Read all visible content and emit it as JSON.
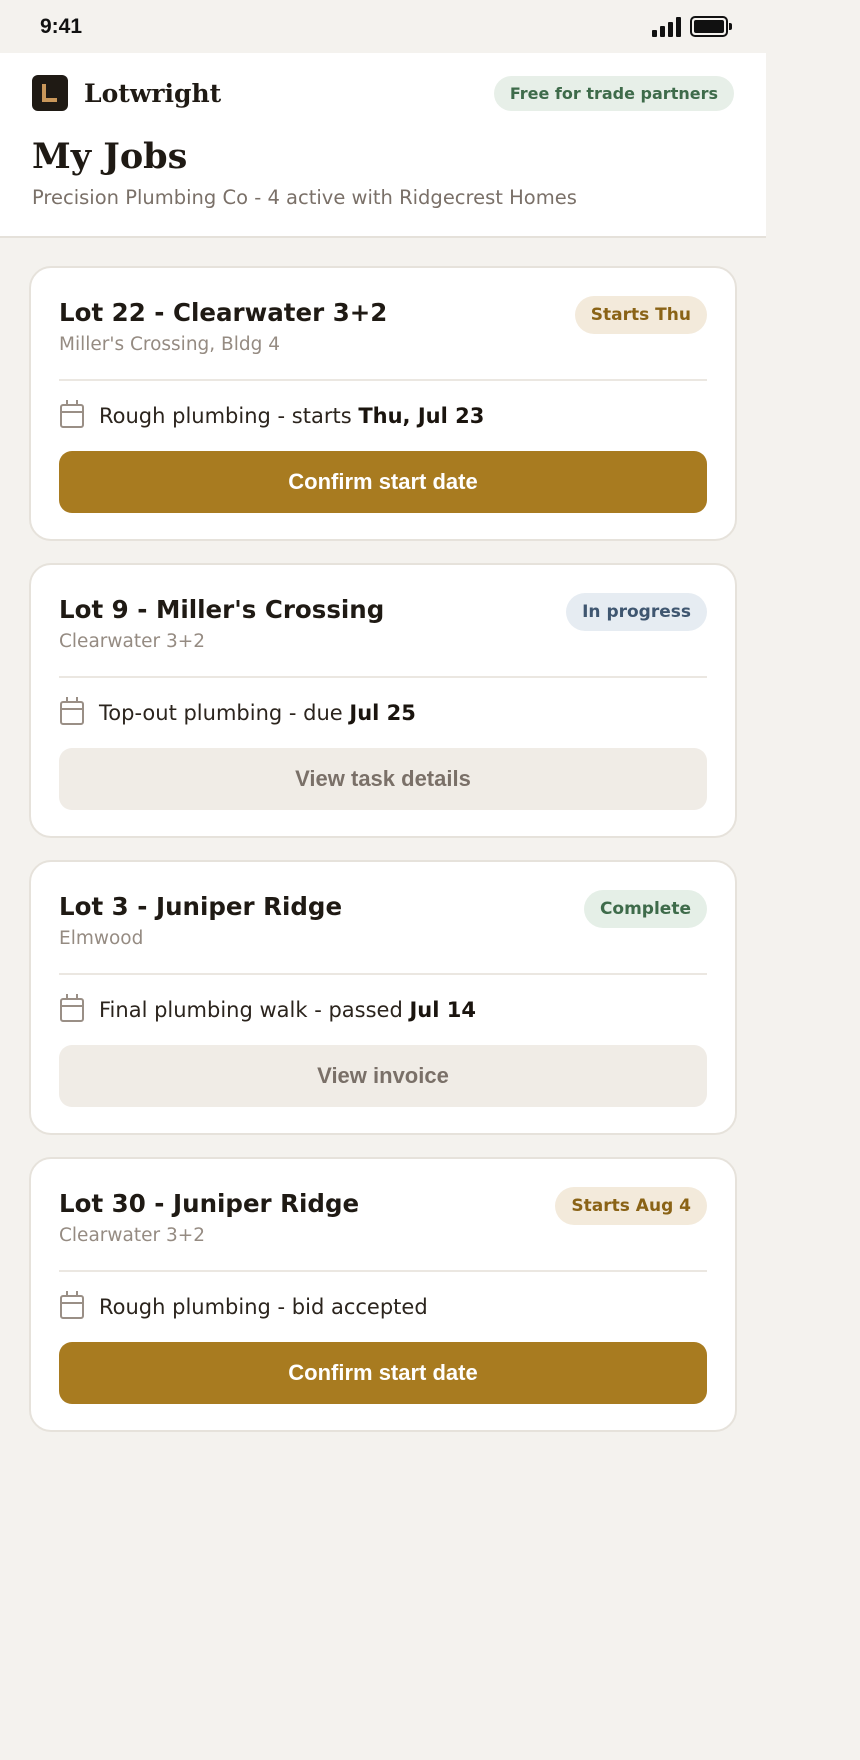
{
  "status_bar": {
    "time": "9:41"
  },
  "app": {
    "name": "Lotwright",
    "partner_badge": "Free for trade partners"
  },
  "page": {
    "title": "My Jobs",
    "subtitle": "Precision Plumbing Co - 4 active with Ridgecrest Homes"
  },
  "jobs": [
    {
      "title": "Lot 22 - Clearwater 3+2",
      "subtitle": "Miller's Crossing, Bldg 4",
      "badge": "Starts Thu",
      "task_text": "Rough plumbing - starts ",
      "task_bold": "Thu, Jul 23",
      "action": "Confirm start date"
    },
    {
      "title": "Lot 9 - Miller's Crossing",
      "subtitle": "Clearwater 3+2",
      "badge": "In progress",
      "task_text": "Top-out plumbing - due ",
      "task_bold": "Jul 25",
      "action": "View task details"
    },
    {
      "title": "Lot 3 - Juniper Ridge",
      "subtitle": "Elmwood",
      "badge": "Complete",
      "task_text": "Final plumbing walk - passed ",
      "task_bold": "Jul 14",
      "action": "View invoice"
    },
    {
      "title": "Lot 30 - Juniper Ridge",
      "subtitle": "Clearwater 3+2",
      "badge": "Starts Aug 4",
      "task_text": "Rough plumbing - bid accepted",
      "task_bold": "",
      "action": "Confirm start date"
    }
  ],
  "colors": {
    "accent": "#a87b20",
    "background": "#f4f2ee",
    "badge_warn": "#f3eadb",
    "badge_info": "#e6ecf2",
    "badge_ok": "#e5efe7"
  }
}
